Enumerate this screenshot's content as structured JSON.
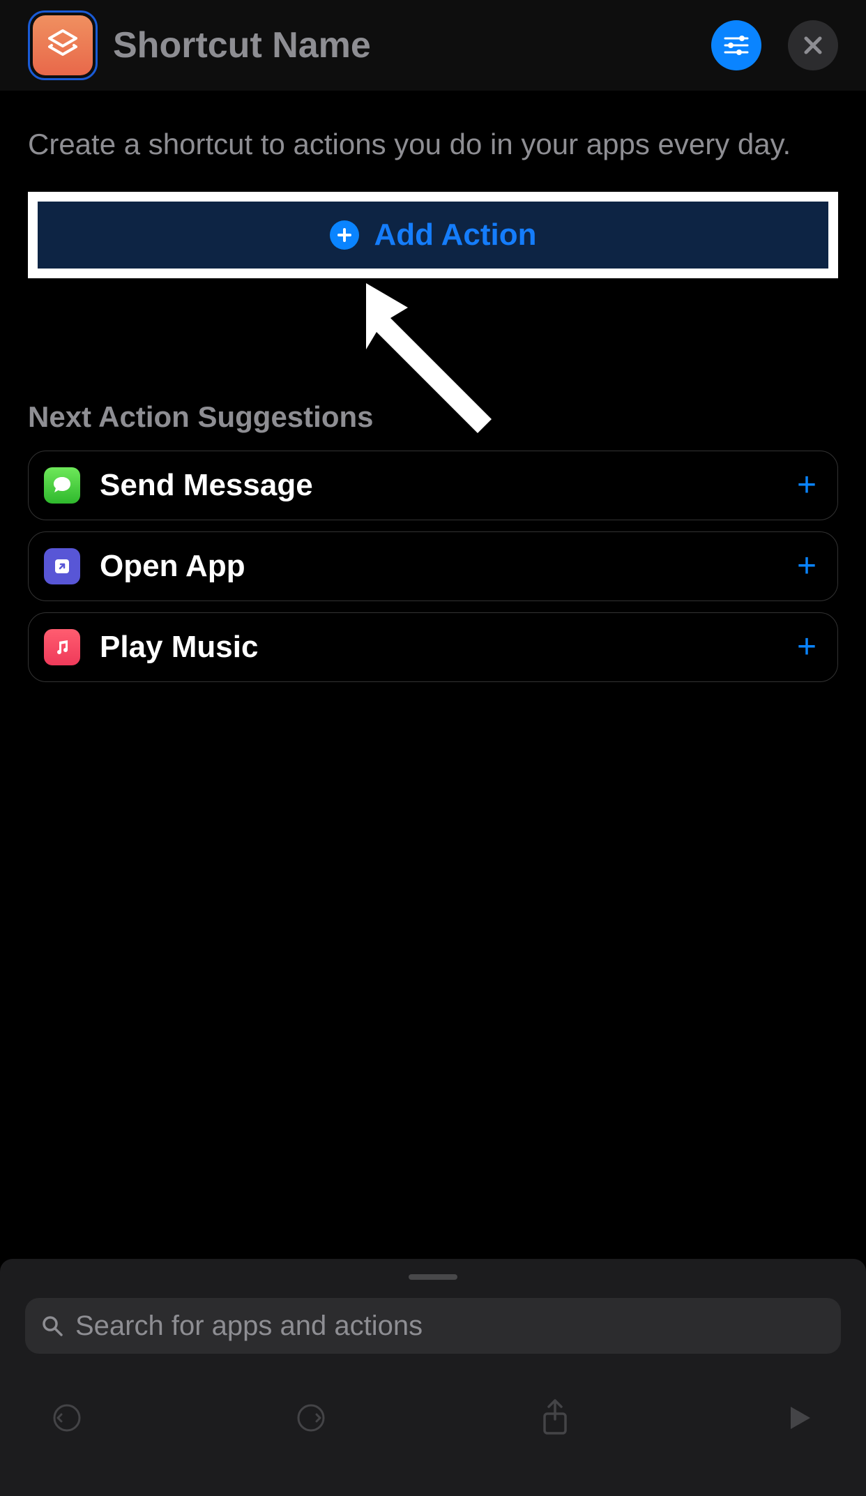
{
  "header": {
    "title": "Shortcut Name"
  },
  "intro": "Create a shortcut to actions you do in your apps every day.",
  "add_action_label": "Add Action",
  "suggestions_title": "Next Action Suggestions",
  "suggestions": [
    {
      "label": "Send Message",
      "icon": "messages"
    },
    {
      "label": "Open App",
      "icon": "openapp"
    },
    {
      "label": "Play Music",
      "icon": "music"
    }
  ],
  "search": {
    "placeholder": "Search for apps and actions"
  }
}
